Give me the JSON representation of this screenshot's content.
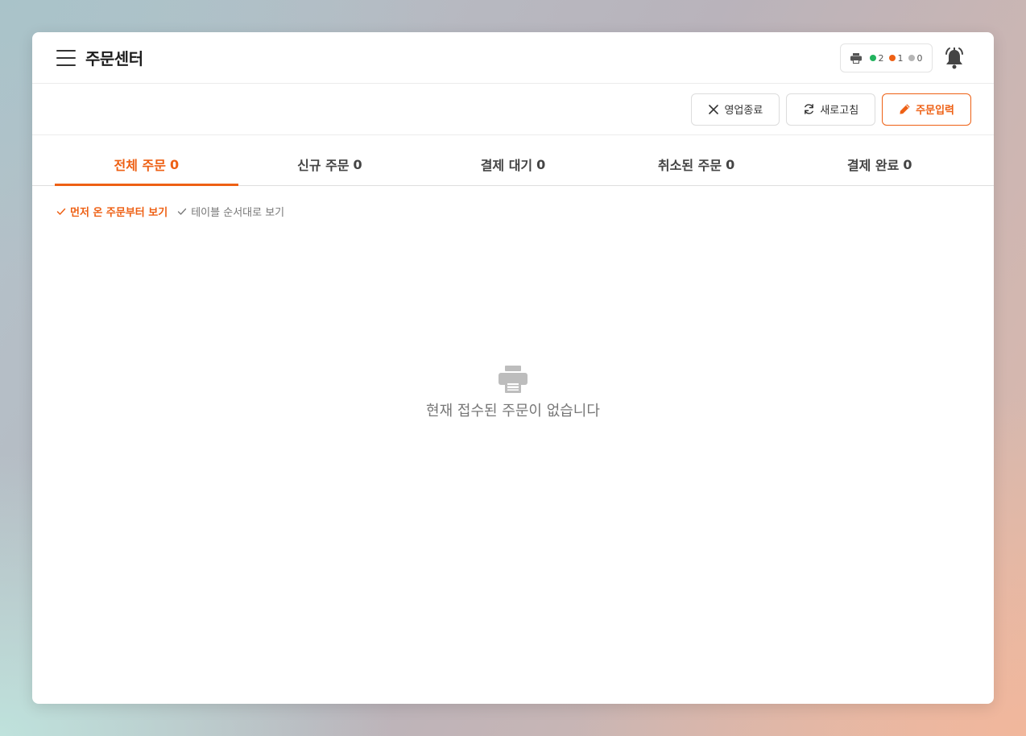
{
  "header": {
    "title": "주문센터",
    "printer_status": [
      {
        "color": "#22b35e",
        "count": "2"
      },
      {
        "color": "#ee6014",
        "count": "1"
      },
      {
        "color": "#b5b5b5",
        "count": "0"
      }
    ]
  },
  "toolbar": {
    "close_label": "영업종료",
    "refresh_label": "새로고침",
    "order_entry_label": "주문입력"
  },
  "tabs": [
    {
      "label": "전체 주문",
      "count": "0",
      "active": true
    },
    {
      "label": "신규 주문",
      "count": "0",
      "active": false
    },
    {
      "label": "결제 대기",
      "count": "0",
      "active": false
    },
    {
      "label": "취소된 주문",
      "count": "0",
      "active": false
    },
    {
      "label": "결제 완료",
      "count": "0",
      "active": false
    }
  ],
  "sort": {
    "first_come": "먼저 온 주문부터 보기",
    "by_table": "테이블 순서대로 보기"
  },
  "empty_state": {
    "icon": "printer-icon",
    "message": "현재 접수된 주문이 없습니다"
  },
  "colors": {
    "accent": "#ee6014",
    "online": "#22b35e",
    "offline": "#b5b5b5"
  }
}
